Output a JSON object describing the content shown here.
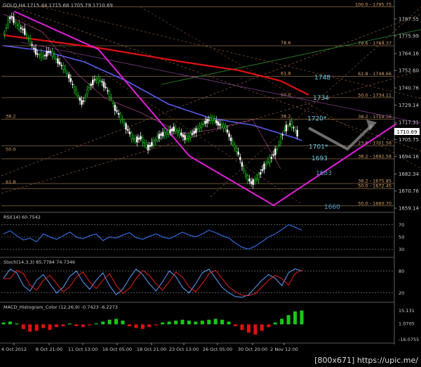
{
  "chart_data": {
    "type": "candlestick",
    "title": "GOLD,H4  1715.44 1715.68 1705.79 1710.69",
    "symbol": "GOLD",
    "timeframe": "H4",
    "ohlc_header": "1715.44 1715.68 1705.79 1710.69",
    "last_price": "1710.69",
    "price_ticks": [
      "1787.55",
      "1775.99",
      "1764.16",
      "1752.60",
      "1740.76",
      "1729.14",
      "1717.31",
      "1705.75",
      "1694.16",
      "1682.34",
      "1670.76",
      "1659.14"
    ],
    "ylim": [
      1656.3,
      1799.0
    ],
    "time_labels": [
      "4 Oct 2012",
      "8 Oct 21:00",
      "11 Oct 13:00",
      "16 Oct 05:00",
      "18 Oct 21:00",
      "23 Oct 13:00",
      "26 Oct 05:00",
      "30 Oct 20:00",
      "2 Nov 12:00"
    ],
    "close_path": [
      1778,
      1790,
      1783,
      1780,
      1772,
      1764,
      1762,
      1766,
      1760,
      1755,
      1748,
      1738,
      1730,
      1741,
      1747,
      1745,
      1738,
      1727,
      1720,
      1712,
      1705,
      1707,
      1700,
      1704,
      1709,
      1710,
      1713,
      1710,
      1706,
      1710,
      1714,
      1718,
      1720,
      1716,
      1714,
      1704,
      1696,
      1682,
      1676,
      1680,
      1688,
      1693,
      1700,
      1712,
      1717,
      1710
    ],
    "fib_levels": [
      {
        "label": "100.0 - 1795.75",
        "price": 1795.75
      },
      {
        "label": "78.6 - 1769.37",
        "price": 1769.37
      },
      {
        "label": "61.8 - 1748.66",
        "price": 1748.66
      },
      {
        "label": "50.0 - 1734.11",
        "price": 1734.11
      },
      {
        "label": "38.2 - 1719.56",
        "price": 1719.56
      },
      {
        "label": "23.6 - 1701.56",
        "price": 1701.56
      },
      {
        "label": "38.2 - 1692.58",
        "price": 1692.58
      },
      {
        "label": "50.0 - 1660.70",
        "price": 1660.7
      },
      {
        "label": "38.2 - 1675.85",
        "price": 1675.85
      },
      {
        "label": "50.0 - 1672.45",
        "price": 1672.45
      }
    ],
    "fib_side_labels": [
      "78.6",
      "61.8",
      "50.0",
      "38.2",
      "38.2",
      "50.0",
      "61.8"
    ],
    "annotations": [
      {
        "text": "1748",
        "price": 1748
      },
      {
        "text": "1734",
        "price": 1734
      },
      {
        "text": "1720*",
        "price": 1720
      },
      {
        "text": "1701*",
        "price": 1701
      },
      {
        "text": "1693",
        "price": 1693
      },
      {
        "text": "1683",
        "price": 1683
      },
      {
        "text": "1660",
        "price": 1660
      }
    ],
    "indicators": [
      {
        "name": "RSI(14) 60.7542",
        "levels": [
          "70",
          "50",
          "30"
        ],
        "values": [
          55,
          60,
          52,
          45,
          48,
          42,
          55,
          50,
          46,
          52,
          58,
          50,
          47,
          52,
          55,
          44,
          50,
          48,
          53,
          57,
          49,
          46,
          51,
          55,
          50,
          47,
          52,
          58,
          53,
          50,
          55,
          61,
          57,
          52,
          48,
          40,
          33,
          30,
          35,
          42,
          50,
          55,
          62,
          70,
          66,
          61
        ]
      },
      {
        "name": "Stoch(14,3,3) 85.7784 74.7346",
        "levels": [
          "80",
          "20"
        ],
        "values": [
          60,
          85,
          75,
          40,
          25,
          55,
          70,
          45,
          20,
          35,
          65,
          80,
          50,
          30,
          55,
          75,
          40,
          15,
          30,
          60,
          85,
          70,
          45,
          25,
          50,
          80,
          65,
          35,
          20,
          45,
          75,
          85,
          60,
          35,
          20,
          10,
          8,
          15,
          35,
          55,
          70,
          60,
          40,
          75,
          86,
          80
        ]
      },
      {
        "name": "MACD_Histogram_Color (12,26,9) -0.7423 -6.2273",
        "levels": [
          "15.131",
          "1.0705",
          "-16.0755"
        ],
        "values": [
          2,
          3,
          1,
          -5,
          -8,
          -7,
          -4,
          -6,
          -3,
          -2,
          1,
          -2,
          -3,
          -1,
          1,
          3,
          5,
          6,
          4,
          -2,
          -4,
          -5,
          -3,
          -1,
          2,
          3,
          4,
          5,
          4,
          3,
          4,
          5,
          6,
          5,
          3,
          -2,
          -6,
          -9,
          -11,
          -7,
          -3,
          2,
          6,
          10,
          14,
          15
        ]
      }
    ],
    "legend": "none",
    "grid": true
  },
  "watermark": "[800x671] https://upic.me/"
}
